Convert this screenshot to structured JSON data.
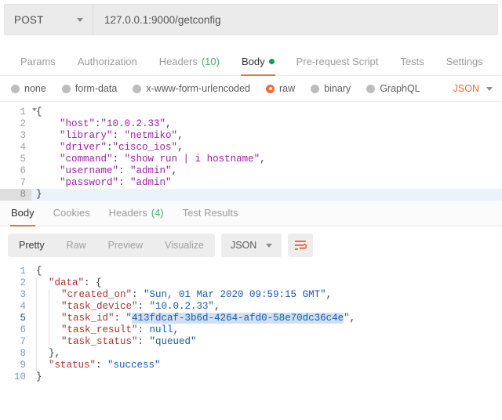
{
  "request_bar": {
    "method": "POST",
    "method_caret_icon": "chevron-down-icon",
    "url": "127.0.0.1:9000/getconfig"
  },
  "request_tabs": [
    {
      "label": "Params",
      "active": false
    },
    {
      "label": "Authorization",
      "active": false
    },
    {
      "label": "Headers",
      "count": "(10)",
      "active": false
    },
    {
      "label": "Body",
      "active": true,
      "dot": true
    },
    {
      "label": "Pre-request Script",
      "active": false
    },
    {
      "label": "Tests",
      "active": false
    },
    {
      "label": "Settings",
      "active": false
    }
  ],
  "body_modes": {
    "options": [
      {
        "label": "none",
        "selected": false
      },
      {
        "label": "form-data",
        "selected": false
      },
      {
        "label": "x-www-form-urlencoded",
        "selected": false
      },
      {
        "label": "raw",
        "selected": true
      },
      {
        "label": "binary",
        "selected": false
      },
      {
        "label": "GraphQL",
        "selected": false
      }
    ],
    "format": "JSON",
    "format_caret_icon": "chevron-down-icon"
  },
  "request_body": {
    "language": "json",
    "lines": [
      {
        "n": "1",
        "fold": true,
        "tokens": [
          {
            "t": "{",
            "c": "p"
          }
        ]
      },
      {
        "n": "2",
        "tokens": [
          {
            "t": "    ",
            "c": "p"
          },
          {
            "t": "\"host\"",
            "c": "k"
          },
          {
            "t": ":",
            "c": "p"
          },
          {
            "t": "\"10.0.2.33\"",
            "c": "s"
          },
          {
            "t": ",",
            "c": "p"
          }
        ]
      },
      {
        "n": "3",
        "tokens": [
          {
            "t": "    ",
            "c": "p"
          },
          {
            "t": "\"library\"",
            "c": "k"
          },
          {
            "t": ": ",
            "c": "p"
          },
          {
            "t": "\"netmiko\"",
            "c": "s"
          },
          {
            "t": ",",
            "c": "p"
          }
        ]
      },
      {
        "n": "4",
        "tokens": [
          {
            "t": "    ",
            "c": "p"
          },
          {
            "t": "\"driver\"",
            "c": "k"
          },
          {
            "t": ":",
            "c": "p"
          },
          {
            "t": "\"cisco_ios\"",
            "c": "s"
          },
          {
            "t": ",",
            "c": "p"
          }
        ]
      },
      {
        "n": "5",
        "tokens": [
          {
            "t": "    ",
            "c": "p"
          },
          {
            "t": "\"command\"",
            "c": "k"
          },
          {
            "t": ": ",
            "c": "p"
          },
          {
            "t": "\"show run | i hostname\"",
            "c": "s"
          },
          {
            "t": ",",
            "c": "p"
          }
        ]
      },
      {
        "n": "6",
        "tokens": [
          {
            "t": "    ",
            "c": "p"
          },
          {
            "t": "\"username\"",
            "c": "k"
          },
          {
            "t": ": ",
            "c": "p"
          },
          {
            "t": "\"admin\"",
            "c": "s"
          },
          {
            "t": ",",
            "c": "p"
          }
        ]
      },
      {
        "n": "7",
        "tokens": [
          {
            "t": "    ",
            "c": "p"
          },
          {
            "t": "\"password\"",
            "c": "k"
          },
          {
            "t": ": ",
            "c": "p"
          },
          {
            "t": "\"admin\"",
            "c": "s"
          }
        ]
      },
      {
        "n": "8",
        "highlight": true,
        "tokens": [
          {
            "t": "}",
            "c": "p"
          }
        ]
      }
    ]
  },
  "response_tabs": [
    {
      "label": "Body",
      "active": true
    },
    {
      "label": "Cookies",
      "active": false
    },
    {
      "label": "Headers",
      "count": "(4)",
      "active": false
    },
    {
      "label": "Test Results",
      "active": false
    }
  ],
  "response_toolbar": {
    "views": [
      {
        "label": "Pretty",
        "active": true
      },
      {
        "label": "Raw",
        "active": false
      },
      {
        "label": "Preview",
        "active": false
      },
      {
        "label": "Visualize",
        "active": false
      }
    ],
    "format": "JSON",
    "format_caret_icon": "chevron-down-icon",
    "wrap_icon": "wrap-text-icon"
  },
  "response_body": {
    "language": "json",
    "lines": [
      {
        "n": "1",
        "indent": 0,
        "tokens": [
          {
            "t": "{",
            "c": "p"
          }
        ]
      },
      {
        "n": "2",
        "indent": 1,
        "tokens": [
          {
            "t": "\"data\"",
            "c": "k"
          },
          {
            "t": ": {",
            "c": "p"
          }
        ]
      },
      {
        "n": "3",
        "indent": 2,
        "tokens": [
          {
            "t": "\"created_on\"",
            "c": "k"
          },
          {
            "t": ": ",
            "c": "p"
          },
          {
            "t": "\"Sun, 01 Mar 2020 09:59:15 GMT\"",
            "c": "s"
          },
          {
            "t": ",",
            "c": "p"
          }
        ]
      },
      {
        "n": "4",
        "indent": 2,
        "tokens": [
          {
            "t": "\"task_device\"",
            "c": "k"
          },
          {
            "t": ": ",
            "c": "p"
          },
          {
            "t": "\"10.0.2.33\"",
            "c": "s"
          },
          {
            "t": ",",
            "c": "p"
          }
        ]
      },
      {
        "n": "5",
        "current": true,
        "indent": 2,
        "tokens": [
          {
            "t": "\"task_id\"",
            "c": "k"
          },
          {
            "t": ": ",
            "c": "p"
          },
          {
            "t": "\"",
            "c": "s"
          },
          {
            "t": "413fdcaf-3b6d-4264-afd0-58e70dc36c4e",
            "c": "s sel-hl"
          },
          {
            "t": "\"",
            "c": "s"
          },
          {
            "t": ",",
            "c": "p"
          }
        ]
      },
      {
        "n": "6",
        "indent": 2,
        "tokens": [
          {
            "t": "\"task_result\"",
            "c": "k"
          },
          {
            "t": ": ",
            "c": "p"
          },
          {
            "t": "null",
            "c": "n"
          },
          {
            "t": ",",
            "c": "p"
          }
        ]
      },
      {
        "n": "7",
        "indent": 2,
        "tokens": [
          {
            "t": "\"task_status\"",
            "c": "k"
          },
          {
            "t": ": ",
            "c": "p"
          },
          {
            "t": "\"queued\"",
            "c": "s"
          }
        ]
      },
      {
        "n": "8",
        "indent": 1,
        "tokens": [
          {
            "t": "},",
            "c": "p"
          }
        ]
      },
      {
        "n": "9",
        "indent": 1,
        "tokens": [
          {
            "t": "\"status\"",
            "c": "k"
          },
          {
            "t": ": ",
            "c": "p"
          },
          {
            "t": "\"success\"",
            "c": "s"
          }
        ]
      },
      {
        "n": "10",
        "indent": 0,
        "tokens": [
          {
            "t": "}",
            "c": "p"
          }
        ]
      }
    ]
  },
  "colors": {
    "accent_orange": "#f26b3a",
    "green": "#0fa24e",
    "request_string": "#9b1fa1",
    "response_key": "#a6322b",
    "response_value": "#1a5aa8",
    "selection": "#cfe0f5",
    "active_line": "#eaf2fb"
  }
}
